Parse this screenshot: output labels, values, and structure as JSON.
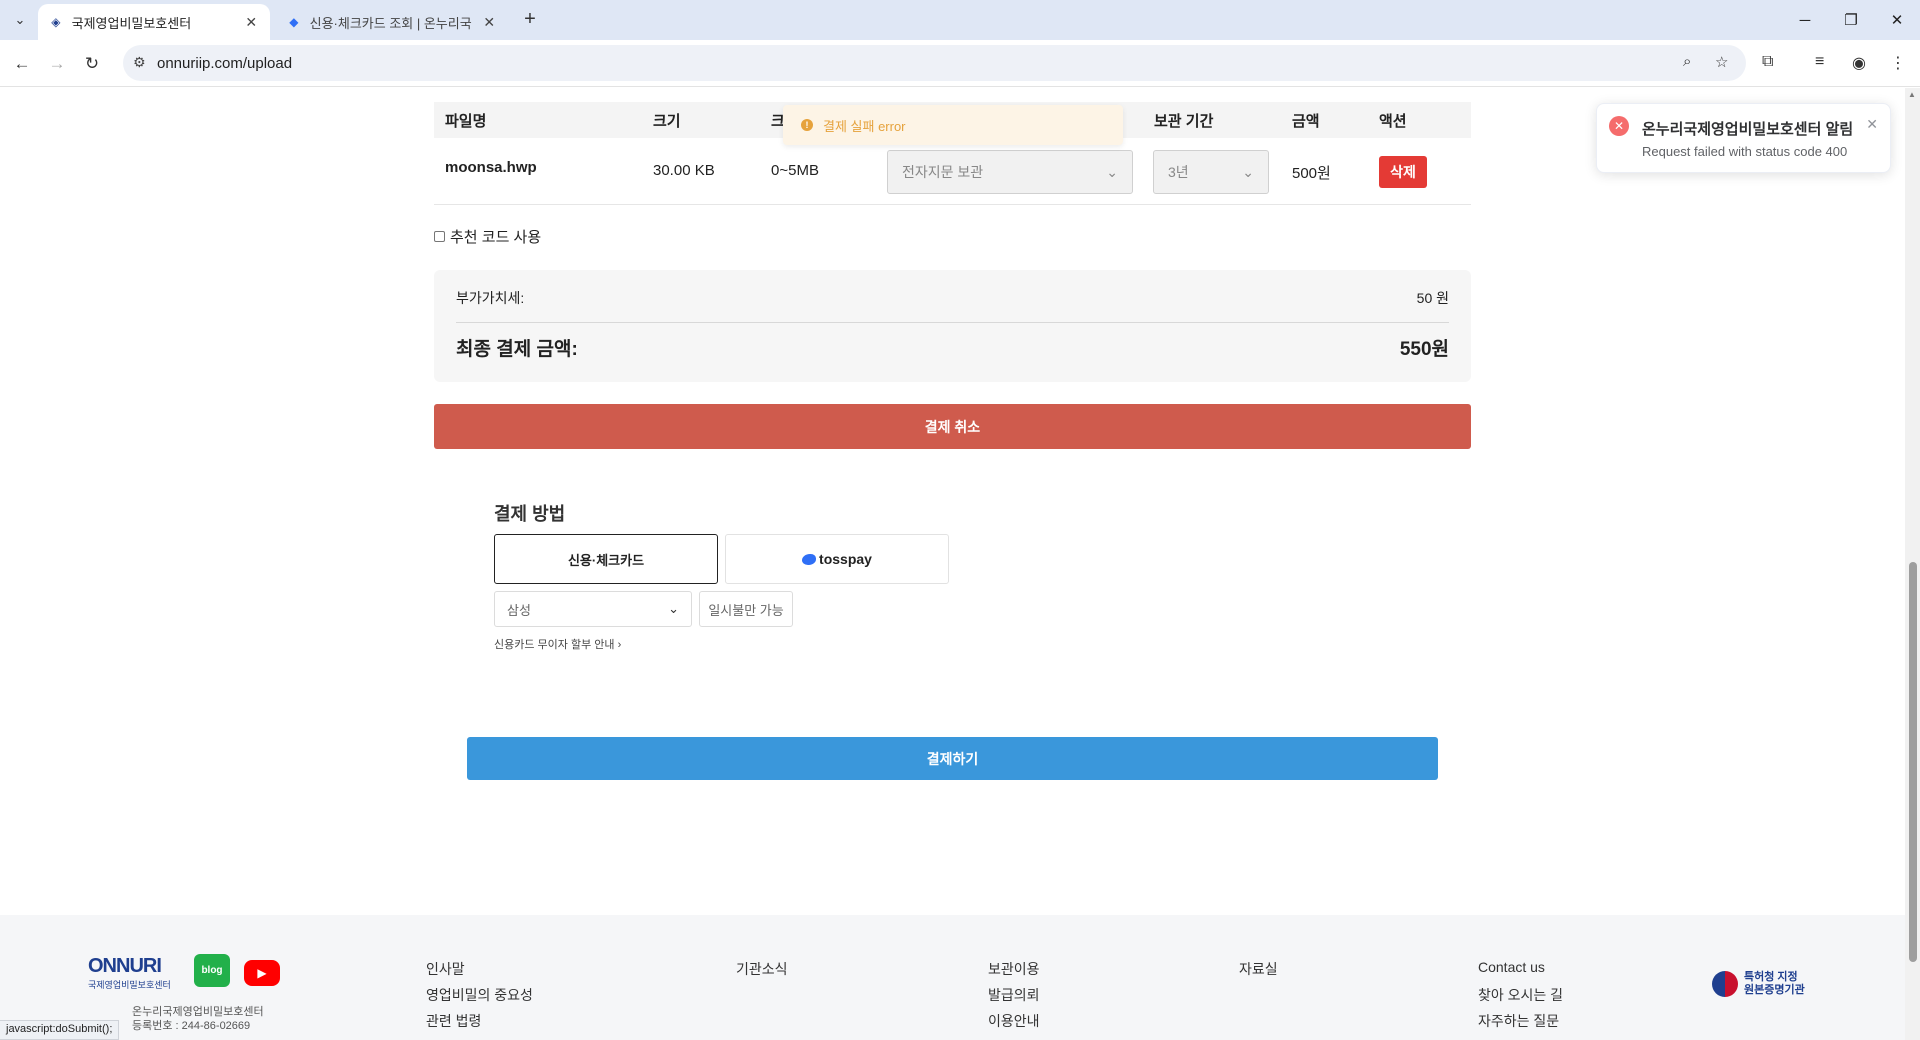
{
  "browser": {
    "tabs": [
      {
        "title": "국제영업비밀보호센터",
        "active": true
      },
      {
        "title": "신용·체크카드 조회 | 온누리국",
        "active": false
      }
    ],
    "url": "onnuriip.com/upload",
    "status_text": "javascript:doSubmit();"
  },
  "table": {
    "headers": {
      "filename": "파일명",
      "size": "크기",
      "range": "크",
      "storage": "보관 기간",
      "amount": "금액",
      "action": "액션"
    },
    "row": {
      "filename": "moonsa.hwp",
      "size": "30.00 KB",
      "range": "0~5MB",
      "storage_type": "전자지문 보관",
      "period": "3년",
      "amount": "500원",
      "delete_label": "삭제"
    }
  },
  "warning_toast": {
    "text": "결제 실패 error"
  },
  "referral": {
    "label": "추천 코드 사용",
    "checked": false
  },
  "summary": {
    "vat_label": "부가가치세:",
    "vat_value": "50 원",
    "total_label": "최종 결제 금액:",
    "total_value": "550원"
  },
  "cancel_label": "결제 취소",
  "payment": {
    "title": "결제 방법",
    "card_label": "신용·체크카드",
    "toss_label": "tosspay",
    "bank_selected": "삼성",
    "lump_label": "일시불만 가능",
    "installment_link": "신용카드 무이자 할부 안내"
  },
  "pay_label": "결제하기",
  "footer": {
    "logo_text": "ONNURI",
    "logo_sub": "국제영업비밀보호센터",
    "blog_label": "blog",
    "col1": [
      "인사말",
      "영업비밀의 중요성",
      "관련 법령"
    ],
    "col2": [
      "기관소식"
    ],
    "col3": [
      "보관이용",
      "발급의뢰",
      "이용안내"
    ],
    "col4": [
      "자료실"
    ],
    "col5": [
      "Contact us",
      "찾아 오시는 길",
      "자주하는 질문"
    ],
    "kipo_line1": "특허청 지정",
    "kipo_line2": "원본증명기관",
    "company_line1": "온누리국제영업비밀보호센터",
    "company_line2": "등록번호 : 244-86-02669"
  },
  "error_toast": {
    "title": "온누리국제영업비밀보호센터 알림",
    "message": "Request failed with status code 400"
  }
}
